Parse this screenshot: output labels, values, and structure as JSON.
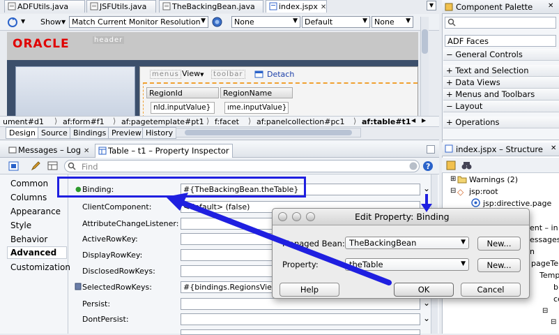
{
  "editor_tabs": [
    {
      "label": "ADFUtils.java"
    },
    {
      "label": "JSFUtils.java"
    },
    {
      "label": "TheBackingBean.java"
    },
    {
      "label": "index.jspx"
    }
  ],
  "palette_title": "Component Palette",
  "toolbar": {
    "show_label": "Show",
    "resolution": "Match Current Monitor Resolution",
    "none1": "None",
    "default": "Default",
    "none2": "None"
  },
  "canvas": {
    "oracle_logo": "ORACLE",
    "header_facet": "header",
    "menus": "menus",
    "view_menu": "View",
    "toolbar_facet": "toolbar",
    "detach": "Detach",
    "col1": "RegionId",
    "col2": "RegionName",
    "cell1": "nId.inputValue}",
    "cell2": "ıme.inputValue}"
  },
  "breadcrumb": [
    "ument#d1",
    "af:form#f1",
    "af:pagetemplate#pt1",
    "f:facet",
    "af:panelcollection#pc1",
    "af:table#t1"
  ],
  "view_tabs": [
    "Design",
    "Source",
    "Bindings",
    "Preview",
    "History"
  ],
  "palette": {
    "library": "ADF Faces",
    "sections": [
      "General Controls",
      "Text and Selection",
      "Data Views",
      "Menus and Toolbars",
      "Layout",
      "Operations"
    ]
  },
  "inspector": {
    "tab_messages": "Messages – Log",
    "tab_inspector": "Table – t1 – Property Inspector",
    "find_placeholder": "Find",
    "categories": [
      "Common",
      "Columns",
      "Appearance",
      "Style",
      "Behavior",
      "Advanced",
      "Customization"
    ],
    "properties": [
      {
        "label": "Binding:",
        "value": "#{TheBackingBean.theTable}"
      },
      {
        "label": "ClientComponent:",
        "value": "<default> (false)"
      },
      {
        "label": "AttributeChangeListener:",
        "value": ""
      },
      {
        "label": "ActiveRowKey:",
        "value": ""
      },
      {
        "label": "DisplayRowKey:",
        "value": ""
      },
      {
        "label": "DisclosedRowKeys:",
        "value": ""
      },
      {
        "label": "SelectedRowKeys:",
        "value": "#{bindings.RegionsView"
      },
      {
        "label": "Persist:",
        "value": ""
      },
      {
        "label": "DontPersist:",
        "value": ""
      }
    ]
  },
  "structure": {
    "title": "index.jspx – Structure",
    "items": [
      "Warnings (2)",
      "jsp:root",
      "jsp:directive.page"
    ],
    "partial": [
      "ent – in",
      "essages",
      "n",
      "pageTe",
      "Temp",
      "b",
      "ce"
    ]
  },
  "dialog": {
    "title": "Edit Property: Binding",
    "managed_bean_label": "Managed Bean:",
    "managed_bean_value": "TheBackingBean",
    "property_label": "Property:",
    "property_value": "theTable",
    "new_label": "New...",
    "help": "Help",
    "ok": "OK",
    "cancel": "Cancel"
  },
  "colors": {
    "accent_blue": "#1f1fe0",
    "oracle_red": "#e00000"
  }
}
